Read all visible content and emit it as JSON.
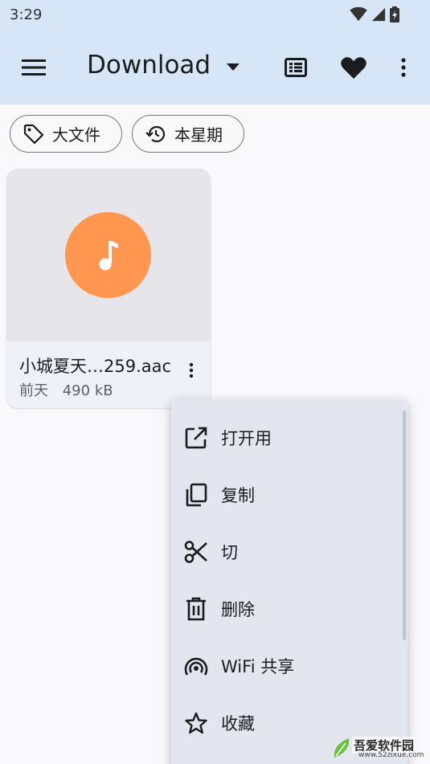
{
  "status": {
    "time": "3:29"
  },
  "appbar": {
    "title": "Download"
  },
  "chips": [
    {
      "label": "大文件",
      "icon": "tag-icon"
    },
    {
      "label": "本星期",
      "icon": "history-icon"
    }
  ],
  "file": {
    "name": "小城夏天…259.aac",
    "date": "前天",
    "size": "490 kB",
    "icon": "music-note-icon",
    "icon_color": "#ff9751"
  },
  "menu": {
    "items": [
      {
        "label": "打开用",
        "icon": "open-external-icon"
      },
      {
        "label": "复制",
        "icon": "copy-icon"
      },
      {
        "label": "切",
        "icon": "scissors-icon"
      },
      {
        "label": "删除",
        "icon": "trash-icon"
      },
      {
        "label": "WiFi 共享",
        "icon": "wifi-share-icon"
      },
      {
        "label": "收藏",
        "icon": "star-icon"
      }
    ]
  },
  "watermark": {
    "name": "吾爱软件园",
    "url": "www.52zixue.com"
  },
  "colors": {
    "appbar": "#d6e6f6",
    "menu_bg": "#e3e6ee",
    "accent": "#ff9751"
  }
}
